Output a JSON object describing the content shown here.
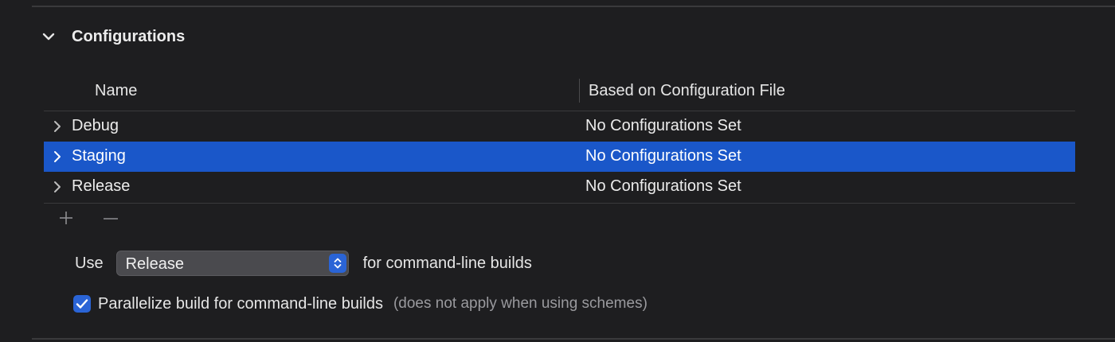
{
  "section": {
    "title": "Configurations",
    "expanded_icon": "chevron-down-icon"
  },
  "table": {
    "columns": [
      "Name",
      "Based on Configuration File"
    ],
    "rows": [
      {
        "name": "Debug",
        "file": "No Configurations Set",
        "selected": false
      },
      {
        "name": "Staging",
        "file": "No Configurations Set",
        "selected": true
      },
      {
        "name": "Release",
        "file": "No Configurations Set",
        "selected": false
      }
    ],
    "row_icon": "chevron-right-icon"
  },
  "controls": {
    "add_icon": "plus-icon",
    "remove_icon": "minus-icon"
  },
  "build": {
    "use_label": "Use",
    "selected_configuration": "Release",
    "use_suffix": "for command-line builds",
    "parallelize_checked": true,
    "parallelize_label": "Parallelize build for command-line builds",
    "parallelize_note": "(does not apply when using schemes)"
  },
  "colors": {
    "background": "#1e1e20",
    "selection": "#1a57c9",
    "accent": "#2a64d6",
    "text": "#e6e6e6",
    "secondary_text": "#9a9a9e"
  }
}
